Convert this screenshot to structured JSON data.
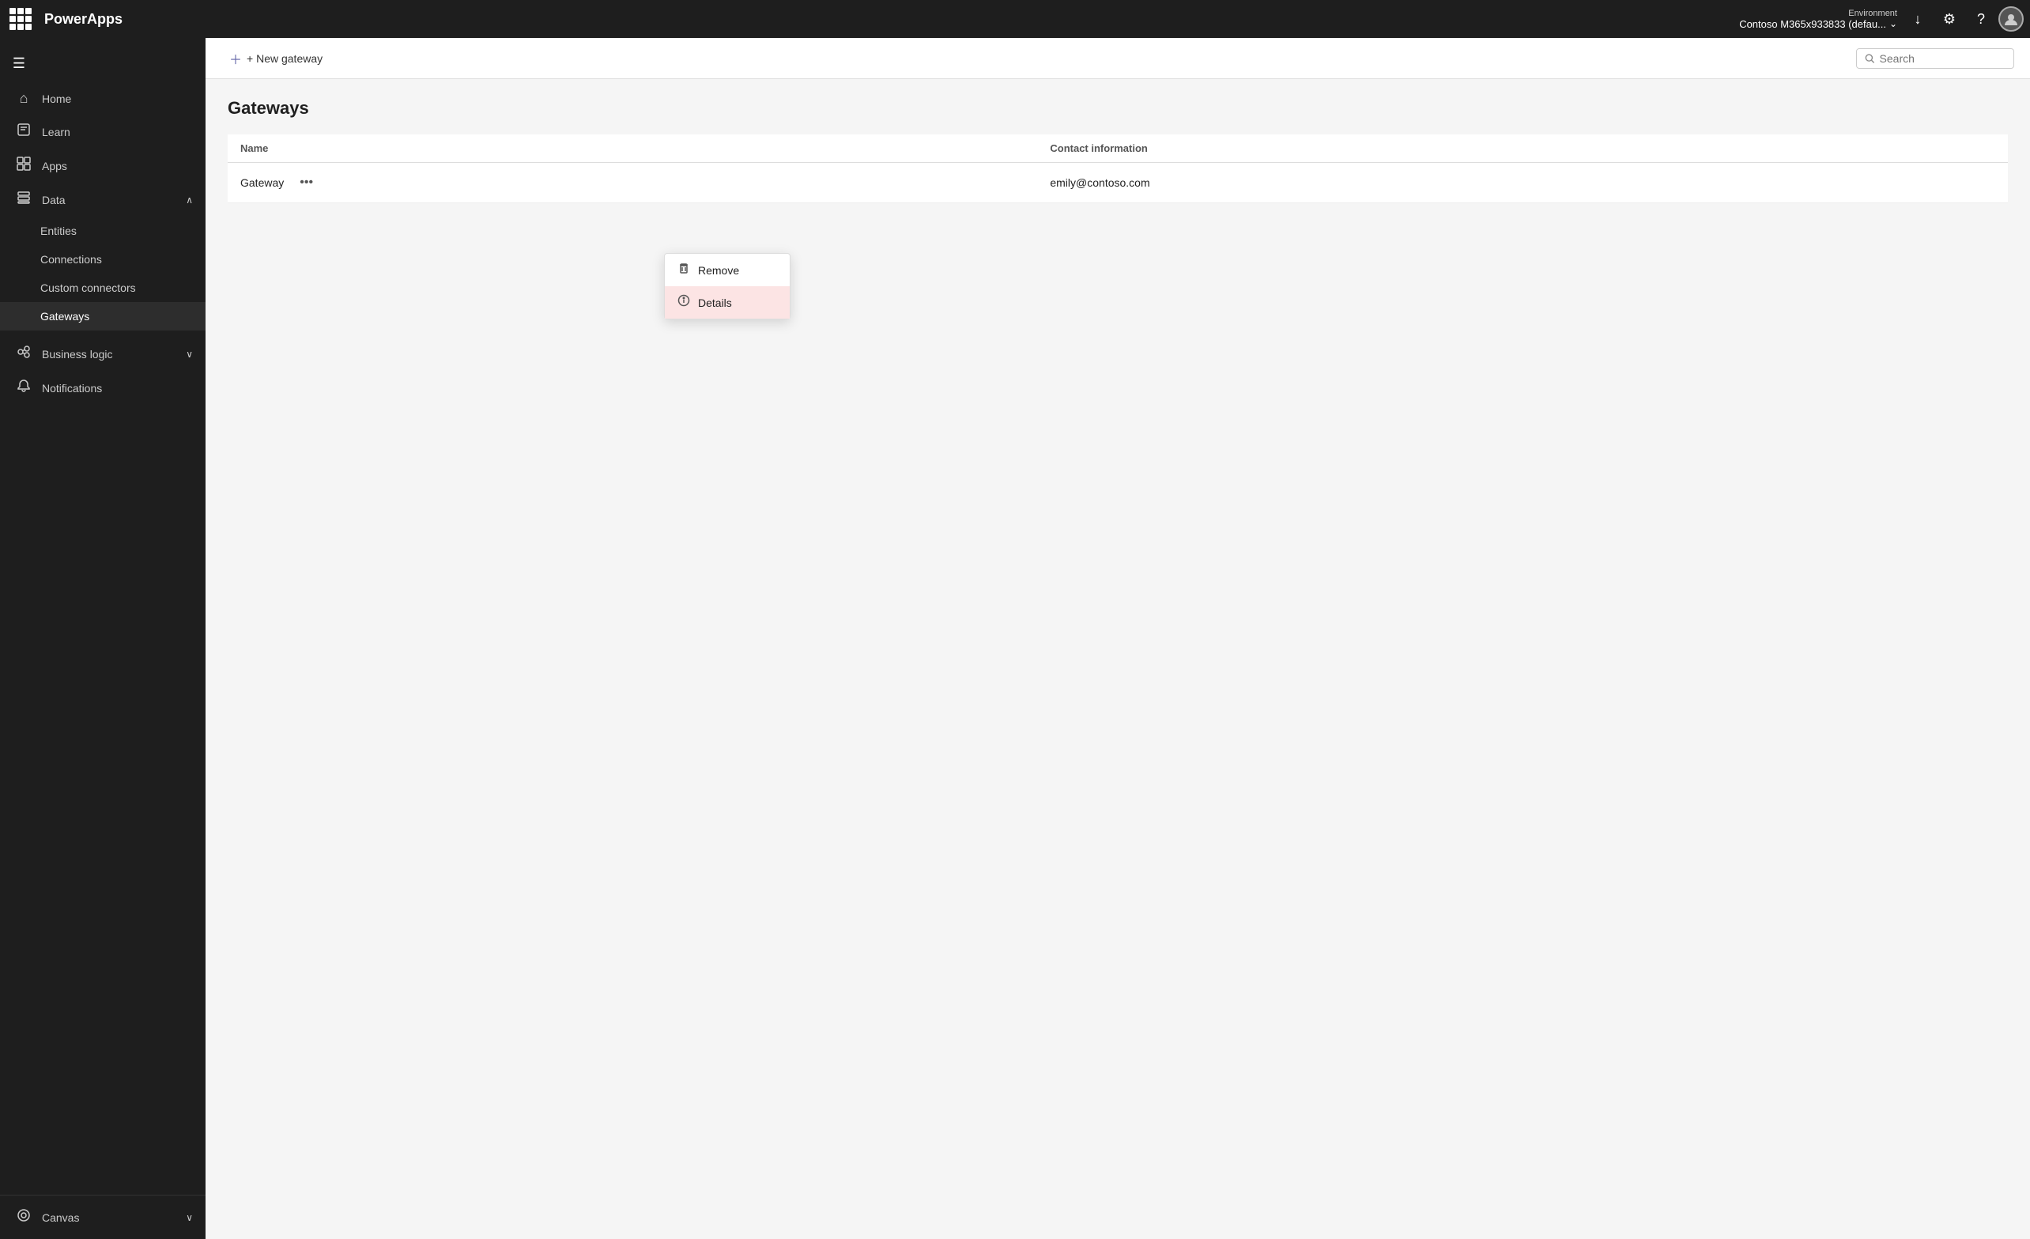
{
  "topbar": {
    "app_name": "PowerApps",
    "environment_label": "Environment",
    "environment_name": "Contoso M365x933833 (defau...",
    "download_icon": "↓",
    "settings_icon": "⚙",
    "help_icon": "?",
    "avatar_initials": ""
  },
  "sidebar": {
    "collapse_icon": "☰",
    "items": [
      {
        "id": "home",
        "label": "Home",
        "icon": "⌂",
        "active": false
      },
      {
        "id": "learn",
        "label": "Learn",
        "icon": "□",
        "active": false
      },
      {
        "id": "apps",
        "label": "Apps",
        "icon": "⊞",
        "active": false
      },
      {
        "id": "data",
        "label": "Data",
        "icon": "⊟",
        "active": false,
        "expanded": true,
        "chevron": "∧"
      }
    ],
    "data_subitems": [
      {
        "id": "entities",
        "label": "Entities",
        "active": false
      },
      {
        "id": "connections",
        "label": "Connections",
        "active": false
      },
      {
        "id": "custom-connectors",
        "label": "Custom connectors",
        "active": false
      },
      {
        "id": "gateways",
        "label": "Gateways",
        "active": true
      }
    ],
    "bottom_items": [
      {
        "id": "business-logic",
        "label": "Business logic",
        "icon": "↗",
        "active": false,
        "chevron": "∨"
      },
      {
        "id": "notifications",
        "label": "Notifications",
        "icon": "🔔",
        "active": false
      }
    ],
    "footer": {
      "label": "Canvas",
      "chevron": "∨"
    }
  },
  "toolbar": {
    "new_gateway_label": "+ New gateway",
    "search_placeholder": "Search"
  },
  "page": {
    "title": "Gateways",
    "table": {
      "columns": [
        {
          "id": "name",
          "label": "Name"
        },
        {
          "id": "contact",
          "label": "Contact information"
        }
      ],
      "rows": [
        {
          "name": "Gateway",
          "contact": "emily@contoso.com"
        }
      ]
    }
  },
  "context_menu": {
    "items": [
      {
        "id": "remove",
        "label": "Remove",
        "icon": "🗑"
      },
      {
        "id": "details",
        "label": "Details",
        "icon": "ℹ",
        "hovered": true
      }
    ]
  },
  "colors": {
    "sidebar_bg": "#1e1e1e",
    "active_border": "#6264a7",
    "topbar_bg": "#1e1e1e",
    "accent": "#6264a7"
  }
}
